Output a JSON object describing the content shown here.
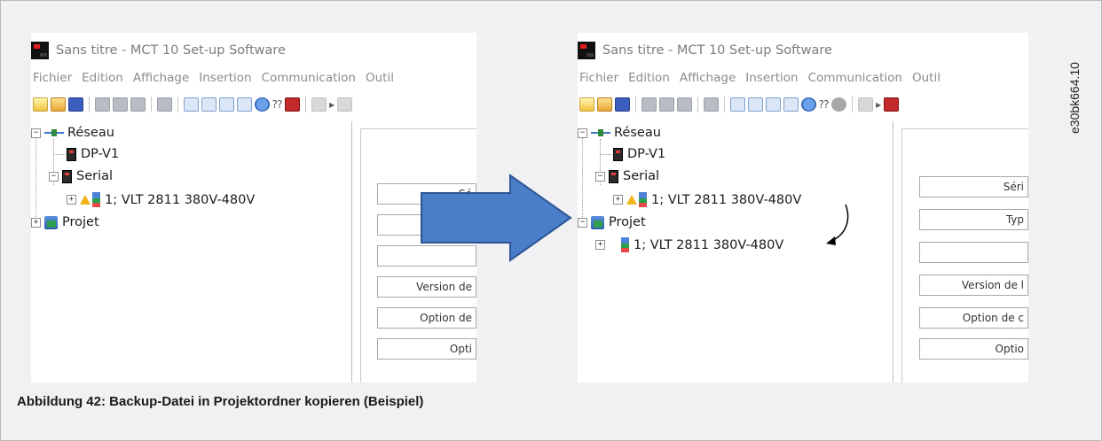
{
  "screenshot_before": {
    "title": "Sans titre - MCT 10 Set-up Software",
    "menu": [
      "Fichier",
      "Edition",
      "Affichage",
      "Insertion",
      "Communication",
      "Outil"
    ],
    "tree": {
      "network": "Réseau",
      "dpv1": "DP-V1",
      "serial": "Serial",
      "drive": "1; VLT 2811 380V-480V",
      "project": "Projet"
    },
    "fields": [
      "Sé",
      "",
      "",
      "Version de",
      "Option de",
      "Opti"
    ]
  },
  "screenshot_after": {
    "title": "Sans titre - MCT 10 Set-up Software",
    "menu": [
      "Fichier",
      "Edition",
      "Affichage",
      "Insertion",
      "Communication",
      "Outil"
    ],
    "tree": {
      "network": "Réseau",
      "dpv1": "DP-V1",
      "serial": "Serial",
      "drive": "1; VLT 2811 380V-480V",
      "project": "Projet",
      "project_drive": "1; VLT 2811 380V-480V"
    },
    "fields": [
      "Séri",
      "Typ",
      "",
      "Version de l",
      "Option de c",
      "Optio"
    ]
  },
  "figure_code": "e30bk664.10",
  "caption": "Abbildung 42: Backup-Datei in Projektordner kopieren (Beispiel)",
  "colors": {
    "arrow_fill": "#4a7ec8",
    "arrow_stroke": "#2c5594",
    "frame_background": "#f1f1f3"
  }
}
